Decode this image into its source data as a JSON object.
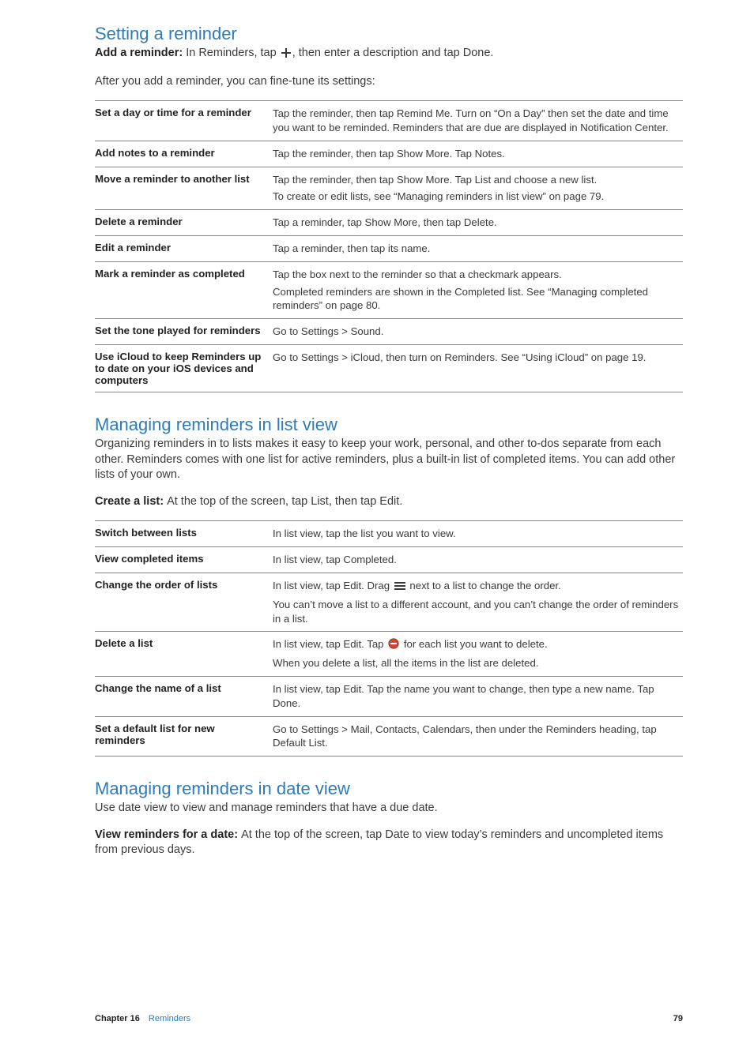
{
  "sections": {
    "setting": {
      "heading": "Setting a reminder",
      "intro_label": "Add a reminder:",
      "intro_rest": "In Reminders, tap",
      "intro_tail": ", then enter a description and tap Done.",
      "after": "After you add a reminder, you can fine-tune its settings:",
      "rows": [
        {
          "l": "Set a day or time for a reminder",
          "r": [
            "Tap the reminder, then tap Remind Me. Turn on “On a Day” then set the date and time you want to be reminded. Reminders that are due are displayed in Notification Center."
          ]
        },
        {
          "l": "Add notes to a reminder",
          "r": [
            "Tap the reminder, then tap Show More. Tap Notes."
          ]
        },
        {
          "l": "Move a reminder to another list",
          "r": [
            "Tap the reminder, then tap Show More. Tap List and choose a new list.",
            "To create or edit lists, see “Managing reminders in list view” on page 79."
          ]
        },
        {
          "l": "Delete a reminder",
          "r": [
            "Tap a reminder, tap Show More, then tap Delete."
          ]
        },
        {
          "l": "Edit a reminder",
          "r": [
            "Tap a reminder, then tap its name."
          ]
        },
        {
          "l": "Mark a reminder as completed",
          "r": [
            "Tap the box next to the reminder so that a checkmark appears.",
            "Completed reminders are shown in the Completed list. See “Managing completed reminders” on page 80."
          ]
        },
        {
          "l": "Set the tone played for reminders",
          "r": [
            "Go to Settings > Sound."
          ]
        },
        {
          "l": "Use iCloud to keep Reminders up to date on your iOS devices and computers",
          "r": [
            "Go to Settings > iCloud, then turn on Reminders. See “Using iCloud” on page 19."
          ]
        }
      ]
    },
    "listview": {
      "heading": "Managing reminders in list view",
      "para": "Organizing reminders in to lists makes it easy to keep your work, personal, and other to-dos separate from each other. Reminders comes with one list for active reminders, plus a built-in list of completed items. You can add other lists of your own.",
      "create_label": "Create a list:",
      "create_rest": "At the top of the screen, tap List, then tap Edit.",
      "rows": [
        {
          "l": "Switch between lists",
          "r": [
            "In list view, tap the list you want to view."
          ]
        },
        {
          "l": "View completed items",
          "r": [
            "In list view, tap Completed."
          ]
        },
        {
          "l": "Change the order of lists",
          "r_pre": "In list view, tap Edit. Drag",
          "r_post": "next to a list to change the order.",
          "r2": "You can’t move a list to a different account, and you can’t change the order of reminders in a list.",
          "icon": "drag"
        },
        {
          "l": "Delete a list",
          "r_pre": "In list view, tap Edit. Tap",
          "r_post": "for each list you want to delete.",
          "r2": "When you delete a list, all the items in the list are deleted.",
          "icon": "delete"
        },
        {
          "l": "Change the name of a list",
          "r": [
            "In list view, tap Edit. Tap the name you want to change, then type a new name. Tap Done."
          ]
        },
        {
          "l": "Set a default list for new reminders",
          "r": [
            "Go to Settings > Mail, Contacts, Calendars, then under the Reminders heading, tap Default List."
          ]
        }
      ]
    },
    "dateview": {
      "heading": "Managing reminders in date view",
      "para": "Use date view to view and manage reminders that have a due date.",
      "view_label": "View reminders for a date:",
      "view_rest": "At the top of the screen, tap Date to view today’s reminders and uncompleted items from previous days."
    }
  },
  "footer": {
    "chapter": "Chapter 16",
    "title": "Reminders",
    "page": "79"
  }
}
